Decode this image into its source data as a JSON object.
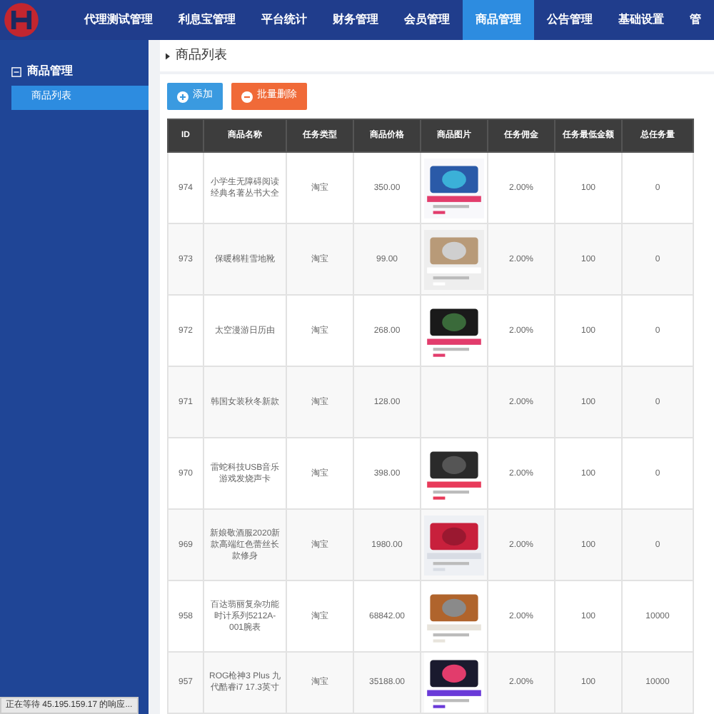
{
  "nav": [
    {
      "label": "代理测试管理",
      "selected": false
    },
    {
      "label": "利息宝管理",
      "selected": false
    },
    {
      "label": "平台统计",
      "selected": false
    },
    {
      "label": "财务管理",
      "selected": false
    },
    {
      "label": "会员管理",
      "selected": false
    },
    {
      "label": "商品管理",
      "selected": true
    },
    {
      "label": "公告管理",
      "selected": false
    },
    {
      "label": "基础设置",
      "selected": false
    },
    {
      "label": "管",
      "selected": false
    }
  ],
  "sidebar": {
    "group": "商品管理",
    "expanded": true,
    "items": [
      {
        "label": "商品列表",
        "selected": true
      }
    ]
  },
  "page_title": "商品列表",
  "buttons": [
    {
      "label": "添加",
      "kind": "add"
    },
    {
      "label": "批量删除",
      "kind": "delete"
    }
  ],
  "table": {
    "columns": [
      "ID",
      "商品名称",
      "任务类型",
      "商品价格",
      "商品图片",
      "任务佣金",
      "任务最低金额",
      "总任务量"
    ],
    "rows": [
      {
        "id": "974",
        "name": "小学生无障碍阅读经典名著丛书大全",
        "type": "淘宝",
        "price": "350.00",
        "commission": "2.00%",
        "min": "100",
        "total": "0"
      },
      {
        "id": "973",
        "name": "保暖棉鞋雪地靴",
        "type": "淘宝",
        "price": "99.00",
        "commission": "2.00%",
        "min": "100",
        "total": "0"
      },
      {
        "id": "972",
        "name": "太空漫游日历由",
        "type": "淘宝",
        "price": "268.00",
        "commission": "2.00%",
        "min": "100",
        "total": "0"
      },
      {
        "id": "971",
        "name": "韩国女装秋冬新款",
        "type": "淘宝",
        "price": "128.00",
        "commission": "2.00%",
        "min": "100",
        "total": "0"
      },
      {
        "id": "970",
        "name": "雷蛇科技USB音乐游戏发烧声卡",
        "type": "淘宝",
        "price": "398.00",
        "commission": "2.00%",
        "min": "100",
        "total": "0"
      },
      {
        "id": "969",
        "name": "新娘敬酒服2020新款高端红色蕾丝长款修身",
        "type": "淘宝",
        "price": "1980.00",
        "commission": "2.00%",
        "min": "100",
        "total": "0"
      },
      {
        "id": "958",
        "name": "百达翡丽复杂功能时计系列5212A-001腕表",
        "type": "淘宝",
        "price": "68842.00",
        "commission": "2.00%",
        "min": "100",
        "total": "10000"
      },
      {
        "id": "957",
        "name": "ROG枪神3 Plus 九代酷睿i7 17.3英寸",
        "type": "淘宝",
        "price": "35188.00",
        "commission": "2.00%",
        "min": "100",
        "total": "10000"
      }
    ]
  },
  "status_bar": "正在等待 45.195.159.17 的响应..."
}
